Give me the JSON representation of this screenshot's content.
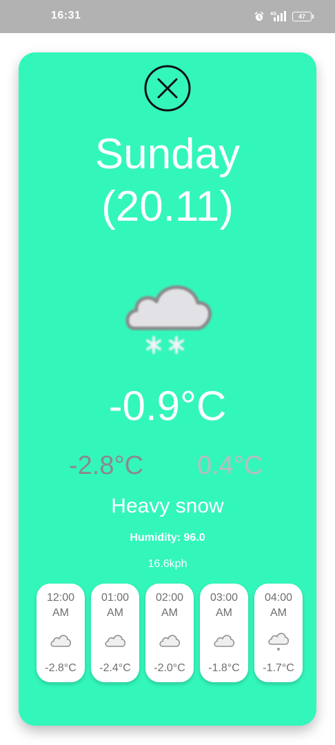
{
  "status_bar": {
    "time": "16:31",
    "network": "4G",
    "battery": "47",
    "icons": [
      "alarm-icon",
      "signal-icon",
      "battery-icon"
    ]
  },
  "forecast": {
    "day": "Sunday",
    "date": "(20.11)",
    "icon": "cloud-snow-icon",
    "temperature": "-0.9°C",
    "min_temp": "-2.8°C",
    "max_temp": "0.4°C",
    "condition": "Heavy snow",
    "humidity": "Humidity: 96.0",
    "wind": "16.6kph"
  },
  "hourly": [
    {
      "time": "12:00\nAM",
      "temp": "-2.8°C",
      "icon": "cloud-icon"
    },
    {
      "time": "01:00\nAM",
      "temp": "-2.4°C",
      "icon": "cloud-icon"
    },
    {
      "time": "02:00\nAM",
      "temp": "-2.0°C",
      "icon": "cloud-icon"
    },
    {
      "time": "03:00\nAM",
      "temp": "-1.8°C",
      "icon": "cloud-icon"
    },
    {
      "time": "04:00\nAM",
      "temp": "-1.7°C",
      "icon": "cloud-rain-icon"
    }
  ],
  "colors": {
    "card_background": "#33f6bb",
    "primary_text": "#ffffff",
    "min_temp": "#8a8a8a",
    "max_temp": "#bcbcbc",
    "status_bar": "#b2b2b2"
  }
}
